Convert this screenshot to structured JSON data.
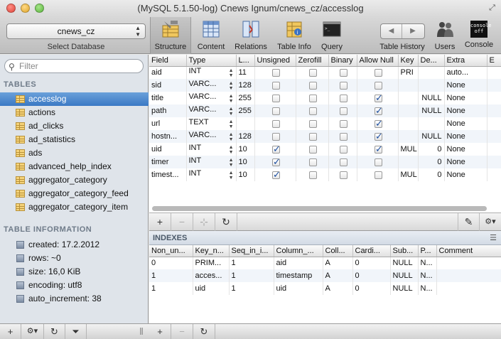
{
  "window": {
    "title": "(MySQL 5.1.50-log) Cnews Ignum/cnews_cz/accesslog"
  },
  "toolbar": {
    "database": "cnews_cz",
    "database_caption": "Select Database",
    "items": [
      {
        "label": "Structure",
        "icon": "structure-icon"
      },
      {
        "label": "Content",
        "icon": "content-icon"
      },
      {
        "label": "Relations",
        "icon": "relations-icon"
      },
      {
        "label": "Table Info",
        "icon": "table-info-icon"
      },
      {
        "label": "Query",
        "icon": "query-icon"
      }
    ],
    "history_label": "Table History",
    "users_label": "Users",
    "console_label": "Console",
    "console_icon_text": "console off"
  },
  "sidebar": {
    "filter_placeholder": "Filter",
    "tables_heading": "TABLES",
    "tables": [
      "accesslog",
      "actions",
      "ad_clicks",
      "ad_statistics",
      "ads",
      "advanced_help_index",
      "aggregator_category",
      "aggregator_category_feed",
      "aggregator_category_item"
    ],
    "selected_table": "accesslog",
    "info_heading": "TABLE INFORMATION",
    "info": [
      "created: 17.2.2012",
      "rows: ~0",
      "size: 16,0 KiB",
      "encoding: utf8",
      "auto_increment: 38"
    ]
  },
  "structure": {
    "columns": [
      "Field",
      "Type",
      "L...",
      "Unsigned",
      "Zerofill",
      "Binary",
      "Allow Null",
      "Key",
      "De...",
      "Extra",
      "E"
    ],
    "rows": [
      {
        "field": "aid",
        "type": "INT",
        "length": "11",
        "unsigned": false,
        "zerofill": false,
        "binary": false,
        "allow_null": false,
        "key": "PRI",
        "default": "",
        "extra": "auto..."
      },
      {
        "field": "sid",
        "type": "VARC...",
        "length": "128",
        "unsigned": false,
        "zerofill": false,
        "binary": false,
        "allow_null": false,
        "key": "",
        "default": "",
        "extra": "None"
      },
      {
        "field": "title",
        "type": "VARC...",
        "length": "255",
        "unsigned": false,
        "zerofill": false,
        "binary": false,
        "allow_null": true,
        "key": "",
        "default": "NULL",
        "extra": "None"
      },
      {
        "field": "path",
        "type": "VARC...",
        "length": "255",
        "unsigned": false,
        "zerofill": false,
        "binary": false,
        "allow_null": true,
        "key": "",
        "default": "NULL",
        "extra": "None"
      },
      {
        "field": "url",
        "type": "TEXT",
        "length": "",
        "unsigned": false,
        "zerofill": false,
        "binary": false,
        "allow_null": true,
        "key": "",
        "default": "",
        "extra": "None"
      },
      {
        "field": "hostn...",
        "type": "VARC...",
        "length": "128",
        "unsigned": false,
        "zerofill": false,
        "binary": false,
        "allow_null": true,
        "key": "",
        "default": "NULL",
        "extra": "None"
      },
      {
        "field": "uid",
        "type": "INT",
        "length": "10",
        "unsigned": true,
        "zerofill": false,
        "binary": false,
        "allow_null": true,
        "key": "MUL",
        "default": "0",
        "extra": "None"
      },
      {
        "field": "timer",
        "type": "INT",
        "length": "10",
        "unsigned": true,
        "zerofill": false,
        "binary": false,
        "allow_null": false,
        "key": "",
        "default": "0",
        "extra": "None"
      },
      {
        "field": "timest...",
        "type": "INT",
        "length": "10",
        "unsigned": true,
        "zerofill": false,
        "binary": false,
        "allow_null": false,
        "key": "MUL",
        "default": "0",
        "extra": "None"
      }
    ]
  },
  "indexes": {
    "heading": "INDEXES",
    "columns": [
      "Non_un...",
      "Key_n...",
      "Seq_in_i...",
      "Column_...",
      "Coll...",
      "Cardi...",
      "Sub...",
      "P...",
      "Comment"
    ],
    "rows": [
      [
        "0",
        "PRIM...",
        "1",
        "aid",
        "A",
        "0",
        "NULL",
        "N...",
        ""
      ],
      [
        "1",
        "acces...",
        "1",
        "timestamp",
        "A",
        "0",
        "NULL",
        "N...",
        ""
      ],
      [
        "1",
        "uid",
        "1",
        "uid",
        "A",
        "0",
        "NULL",
        "N...",
        ""
      ]
    ]
  },
  "colors": {
    "selection": "#3b79c4",
    "sidebar": "#dfe4ea",
    "alt_row": "#f1f5fa"
  }
}
